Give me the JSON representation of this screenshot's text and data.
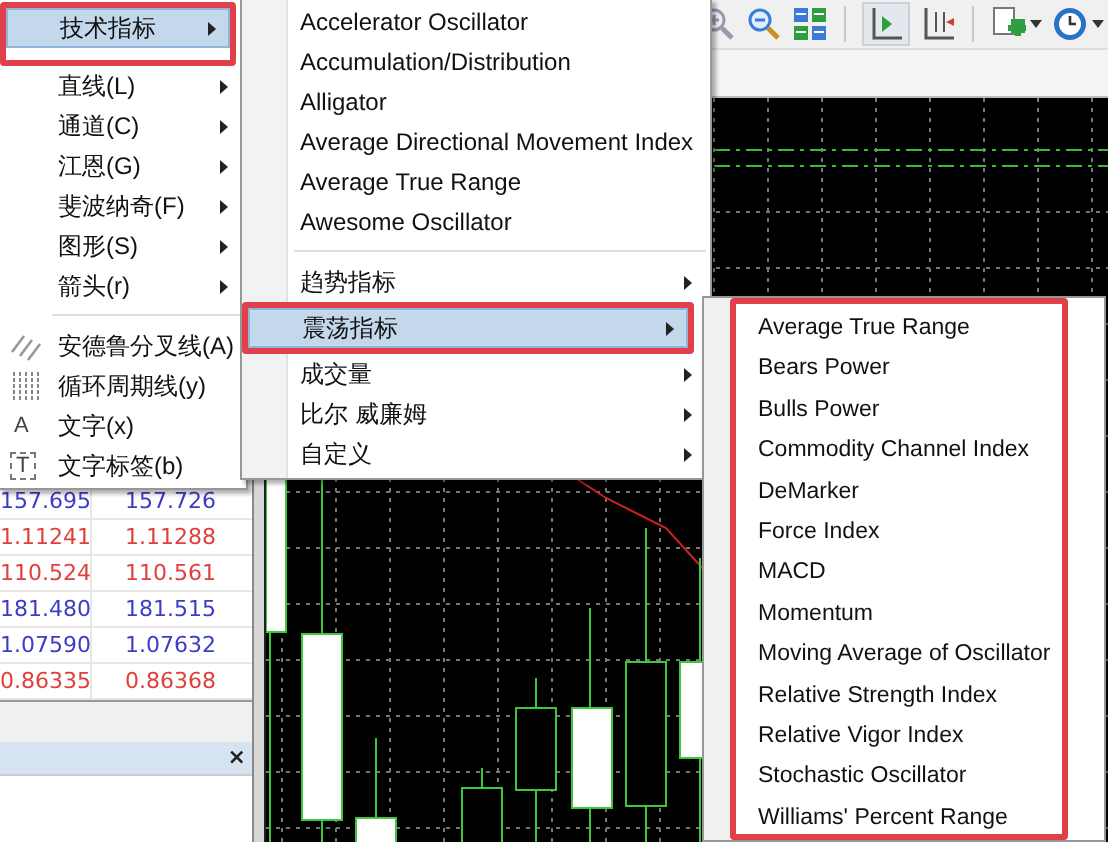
{
  "menus": [
    {
      "annotated": false,
      "items": [
        {
          "kind": "item",
          "label": "技术指标",
          "selected": true,
          "submenu": true,
          "annotated": true
        },
        {
          "kind": "item",
          "label": "直线(L)",
          "selected": false,
          "submenu": true,
          "annotated": false
        },
        {
          "kind": "item",
          "label": "通道(C)",
          "selected": false,
          "submenu": true,
          "annotated": false
        },
        {
          "kind": "item",
          "label": "江恩(G)",
          "selected": false,
          "submenu": true,
          "annotated": false
        },
        {
          "kind": "item",
          "label": "斐波纳奇(F)",
          "selected": false,
          "submenu": true,
          "annotated": false
        },
        {
          "kind": "item",
          "label": "图形(S)",
          "selected": false,
          "submenu": true,
          "annotated": false
        },
        {
          "kind": "item",
          "label": "箭头(r)",
          "selected": false,
          "submenu": true,
          "annotated": false
        },
        {
          "kind": "separator"
        },
        {
          "kind": "tool",
          "label": "安德鲁分叉线(A)",
          "selected": false,
          "submenu": false,
          "annotated": false
        },
        {
          "kind": "tool",
          "label": "循环周期线(y)",
          "selected": false,
          "submenu": false,
          "annotated": false
        },
        {
          "kind": "tool",
          "label": "文字(x)",
          "glyph": "A",
          "selected": false,
          "submenu": false,
          "annotated": false
        },
        {
          "kind": "tool",
          "label": "文字标签(b)",
          "glyph": "T",
          "selected": false,
          "submenu": false,
          "annotated": false
        }
      ]
    },
    {
      "annotated": false,
      "items": [
        {
          "kind": "item",
          "label": "Accelerator Oscillator",
          "selected": false,
          "submenu": false,
          "annotated": false
        },
        {
          "kind": "item",
          "label": "Accumulation/Distribution",
          "selected": false,
          "submenu": false,
          "annotated": false
        },
        {
          "kind": "item",
          "label": "Alligator",
          "selected": false,
          "submenu": false,
          "annotated": false
        },
        {
          "kind": "item",
          "label": "Average Directional Movement Index",
          "selected": false,
          "submenu": false,
          "annotated": false
        },
        {
          "kind": "item",
          "label": "Average True Range",
          "selected": false,
          "submenu": false,
          "annotated": false
        },
        {
          "kind": "item",
          "label": "Awesome Oscillator",
          "selected": false,
          "submenu": false,
          "annotated": false
        },
        {
          "kind": "separator"
        },
        {
          "kind": "item",
          "label": "趋势指标",
          "selected": false,
          "submenu": true,
          "annotated": false
        },
        {
          "kind": "item",
          "label": "震荡指标",
          "selected": true,
          "submenu": true,
          "annotated": true
        },
        {
          "kind": "item",
          "label": "成交量",
          "selected": false,
          "submenu": true,
          "annotated": false
        },
        {
          "kind": "item",
          "label": "比尔 威廉姆",
          "selected": false,
          "submenu": true,
          "annotated": false
        },
        {
          "kind": "item",
          "label": "自定义",
          "selected": false,
          "submenu": true,
          "annotated": false
        }
      ]
    },
    {
      "annotated": true,
      "items": [
        {
          "kind": "item",
          "label": "Average True Range",
          "selected": false,
          "submenu": false,
          "annotated": false
        },
        {
          "kind": "item",
          "label": "Bears Power",
          "selected": false,
          "submenu": false,
          "annotated": false
        },
        {
          "kind": "item",
          "label": "Bulls Power",
          "selected": false,
          "submenu": false,
          "annotated": false
        },
        {
          "kind": "item",
          "label": "Commodity Channel Index",
          "selected": false,
          "submenu": false,
          "annotated": false
        },
        {
          "kind": "item",
          "label": "DeMarker",
          "selected": false,
          "submenu": false,
          "annotated": false
        },
        {
          "kind": "item",
          "label": "Force Index",
          "selected": false,
          "submenu": false,
          "annotated": false
        },
        {
          "kind": "item",
          "label": "MACD",
          "selected": false,
          "submenu": false,
          "annotated": false
        },
        {
          "kind": "item",
          "label": "Momentum",
          "selected": false,
          "submenu": false,
          "annotated": false
        },
        {
          "kind": "item",
          "label": "Moving Average of Oscillator",
          "selected": false,
          "submenu": false,
          "annotated": false
        },
        {
          "kind": "item",
          "label": "Relative Strength Index",
          "selected": false,
          "submenu": false,
          "annotated": false
        },
        {
          "kind": "item",
          "label": "Relative Vigor Index",
          "selected": false,
          "submenu": false,
          "annotated": false
        },
        {
          "kind": "item",
          "label": "Stochastic Oscillator",
          "selected": false,
          "submenu": false,
          "annotated": false
        },
        {
          "kind": "item",
          "label": "Williams' Percent Range",
          "selected": false,
          "submenu": false,
          "annotated": false
        }
      ]
    }
  ],
  "quotes": [
    {
      "bid": "157.695",
      "ask": "157.726",
      "color": "#3c3cc8"
    },
    {
      "bid": "1.11241",
      "ask": "1.11288",
      "color": "#e0403c"
    },
    {
      "bid": "110.524",
      "ask": "110.561",
      "color": "#e0403c"
    },
    {
      "bid": "181.480",
      "ask": "181.515",
      "color": "#3c3cc8"
    },
    {
      "bid": "1.07590",
      "ask": "1.07632",
      "color": "#3c3cc8"
    },
    {
      "bid": "0.86335",
      "ask": "0.86368",
      "color": "#e0403c"
    }
  ],
  "panel": {
    "close": "×"
  }
}
